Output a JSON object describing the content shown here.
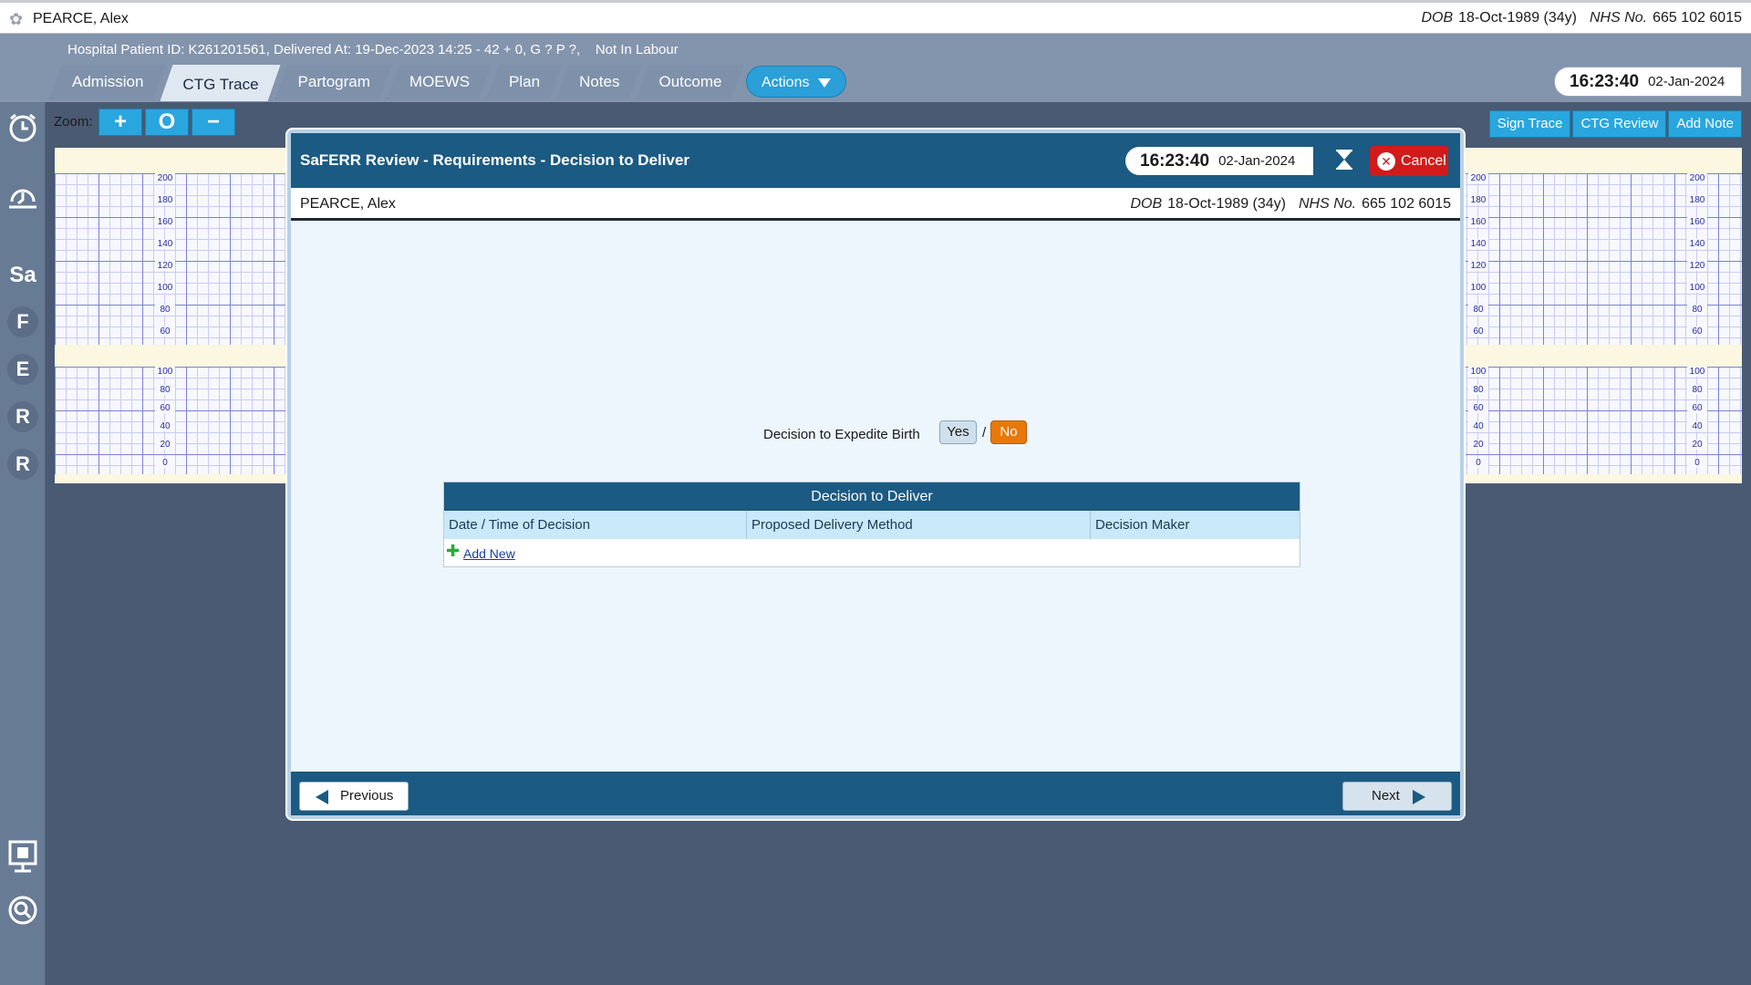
{
  "patient": {
    "name": "PEARCE, Alex",
    "dob_label": "DOB",
    "dob": "18-Oct-1989 (34y)",
    "nhs_label": "NHS No.",
    "nhs": "665 102 6015"
  },
  "header": {
    "info": "Hospital Patient ID: K261201561, Delivered At: 19-Dec-2023 14:25 - 42 + 0, G ? P ?,    Not In Labour",
    "tabs": [
      {
        "label": "Admission",
        "active": false
      },
      {
        "label": "CTG Trace",
        "active": true
      },
      {
        "label": "Partogram",
        "active": false
      },
      {
        "label": "MOEWS",
        "active": false
      },
      {
        "label": "Plan",
        "active": false
      },
      {
        "label": "Notes",
        "active": false
      },
      {
        "label": "Outcome",
        "active": false
      }
    ],
    "actions_label": "Actions",
    "clock_time": "16:23:40",
    "clock_date": "02-Jan-2024"
  },
  "rail": {
    "letters": [
      "Sa",
      "F",
      "E",
      "R",
      "R"
    ]
  },
  "toolbar": {
    "zoom_label": "Zoom:",
    "zoom_in": "+",
    "zoom_reset": "O",
    "zoom_out": "−",
    "sign_trace": "Sign Trace",
    "ctg_review": "CTG Review",
    "add_note": "Add Note"
  },
  "chart": {
    "fhr_scale": [
      "200",
      "180",
      "160",
      "140",
      "120",
      "100",
      "80",
      "60"
    ],
    "toco_scale": [
      "100",
      "80",
      "60",
      "40",
      "20",
      "0"
    ]
  },
  "modal": {
    "title": "SaFERR Review - Requirements - Decision to Deliver",
    "clock_time": "16:23:40",
    "clock_date": "02-Jan-2024",
    "cancel_label": "Cancel",
    "expedite_label": "Decision to Expedite Birth",
    "yes_label": "Yes",
    "slash": "/",
    "no_label": "No",
    "selected": "No",
    "table": {
      "title": "Decision to Deliver",
      "columns": [
        "Date / Time of Decision",
        "Proposed Delivery Method",
        "Decision Maker"
      ],
      "add_new": "Add New"
    },
    "previous_label": "Previous",
    "next_label": "Next"
  },
  "colors": {
    "accent": "#2aa6de",
    "modal_header": "#1b5a82",
    "selected_no": "#e8780a",
    "cancel": "#d11b1b"
  }
}
